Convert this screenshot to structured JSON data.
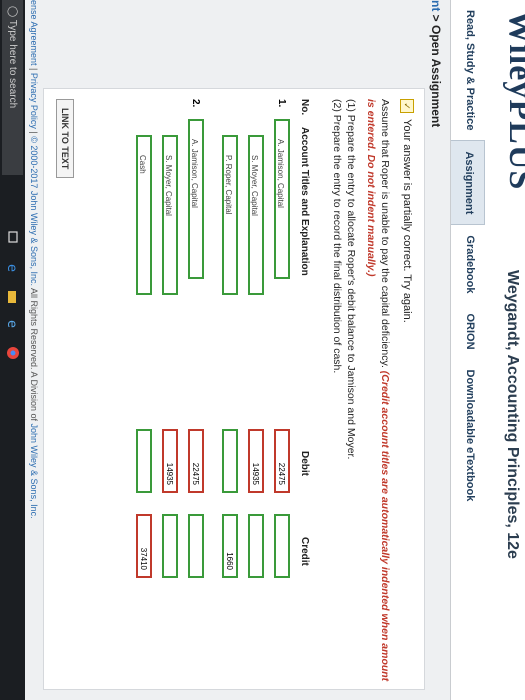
{
  "header": {
    "brand": "WileyPLUS",
    "course_title": "Weygandt, Accounting Principles, 12e",
    "tabs": [
      "Read, Study & Practice",
      "Assignment",
      "Gradebook",
      "ORION",
      "Downloadable eTextbook"
    ]
  },
  "breadcrumb": {
    "link": "nt",
    "sep": " > ",
    "current": "Open Assignment"
  },
  "status_text": "Your answer is partially correct.  Try again.",
  "question": {
    "text": "Assume that Roper is unable to pay the capital deficiency.",
    "note": "(Credit account titles are automatically indented when amount is entered. Do not indent manually.)",
    "part1": "(1)  Prepare the entry to allocate Roper's debit balance to Jamison and Moyer.",
    "part2": "(2)  Prepare the entry to record the final distribution of cash."
  },
  "table": {
    "headers": {
      "no": "No.",
      "account": "Account Titles and Explanation",
      "debit": "Debit",
      "credit": "Credit"
    },
    "rows": [
      {
        "no": "1.",
        "account": "A. Jamison, Capital",
        "debit": "22475",
        "credit": ""
      },
      {
        "no": "",
        "account": "S. Moyer, Capital",
        "debit": "14935",
        "credit": ""
      },
      {
        "no": "",
        "account": "P. Roper, Capital",
        "debit": "",
        "credit": "1660"
      },
      {
        "no": "2.",
        "account": "A. Jamison, Capital",
        "debit": "22475",
        "credit": ""
      },
      {
        "no": "",
        "account": "S. Moyer, Capital",
        "debit": "14935",
        "credit": ""
      },
      {
        "no": "",
        "account": "Cash",
        "debit": "",
        "credit": "37410"
      }
    ]
  },
  "link_button": "LINK TO TEXT",
  "footer": {
    "a": "ense Agreement",
    "sep": " | ",
    "b": "Privacy Policy",
    "c": "© 2000-2017 John Wiley & Sons, Inc.",
    "d": " All Rights Reserved. A Division of ",
    "e": "John Wiley & Sons, Inc."
  },
  "taskbar": {
    "search_placeholder": "Type here to search"
  }
}
